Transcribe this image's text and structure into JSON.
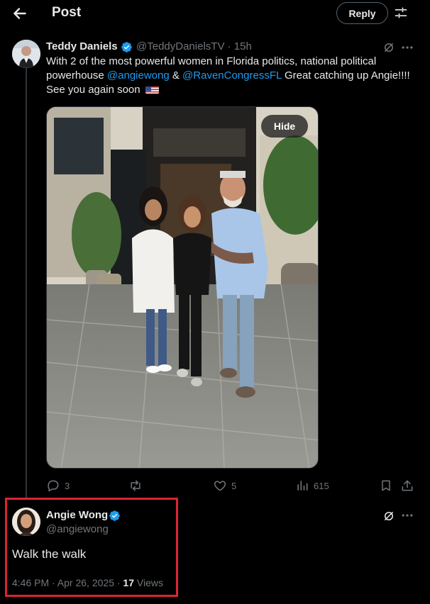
{
  "header": {
    "title": "Post",
    "reply_label": "Reply"
  },
  "tweet": {
    "author_name": "Teddy Daniels",
    "author_handle": "@TeddyDanielsTV",
    "time_sep": " · ",
    "time": "15h",
    "text_part1": "With 2 of the most powerful women in Florida politics, national political powerhouse ",
    "mention1": "@angiewong",
    "text_part2": "  & ",
    "mention2": "@RavenCongressFL",
    "text_part3": "  Great catching up Angie!!!!  See you again soon ",
    "hide_label": "Hide",
    "stats": {
      "replies": "3",
      "likes": "5",
      "views": "615"
    }
  },
  "reply": {
    "author_name": "Angie Wong",
    "author_handle": "@angiewong",
    "text": "Walk the walk",
    "timestamp": "4:46 PM · Apr 26, 2025 · ",
    "views_count": "17",
    "views_label": " Views"
  },
  "icons": {
    "back": "arrow-left-icon",
    "tune": "sliders-icon",
    "verified": "verified-badge-icon",
    "grok": "grok-icon",
    "more": "more-dots-icon",
    "reply": "comment-icon",
    "repost": "repost-icon",
    "like": "heart-icon",
    "views": "views-bar-chart-icon",
    "bookmark": "bookmark-icon",
    "share": "share-icon"
  },
  "colors": {
    "accent": "#1d9bf0",
    "background": "#000000",
    "highlight_box": "#d92632",
    "muted": "#71767b"
  }
}
